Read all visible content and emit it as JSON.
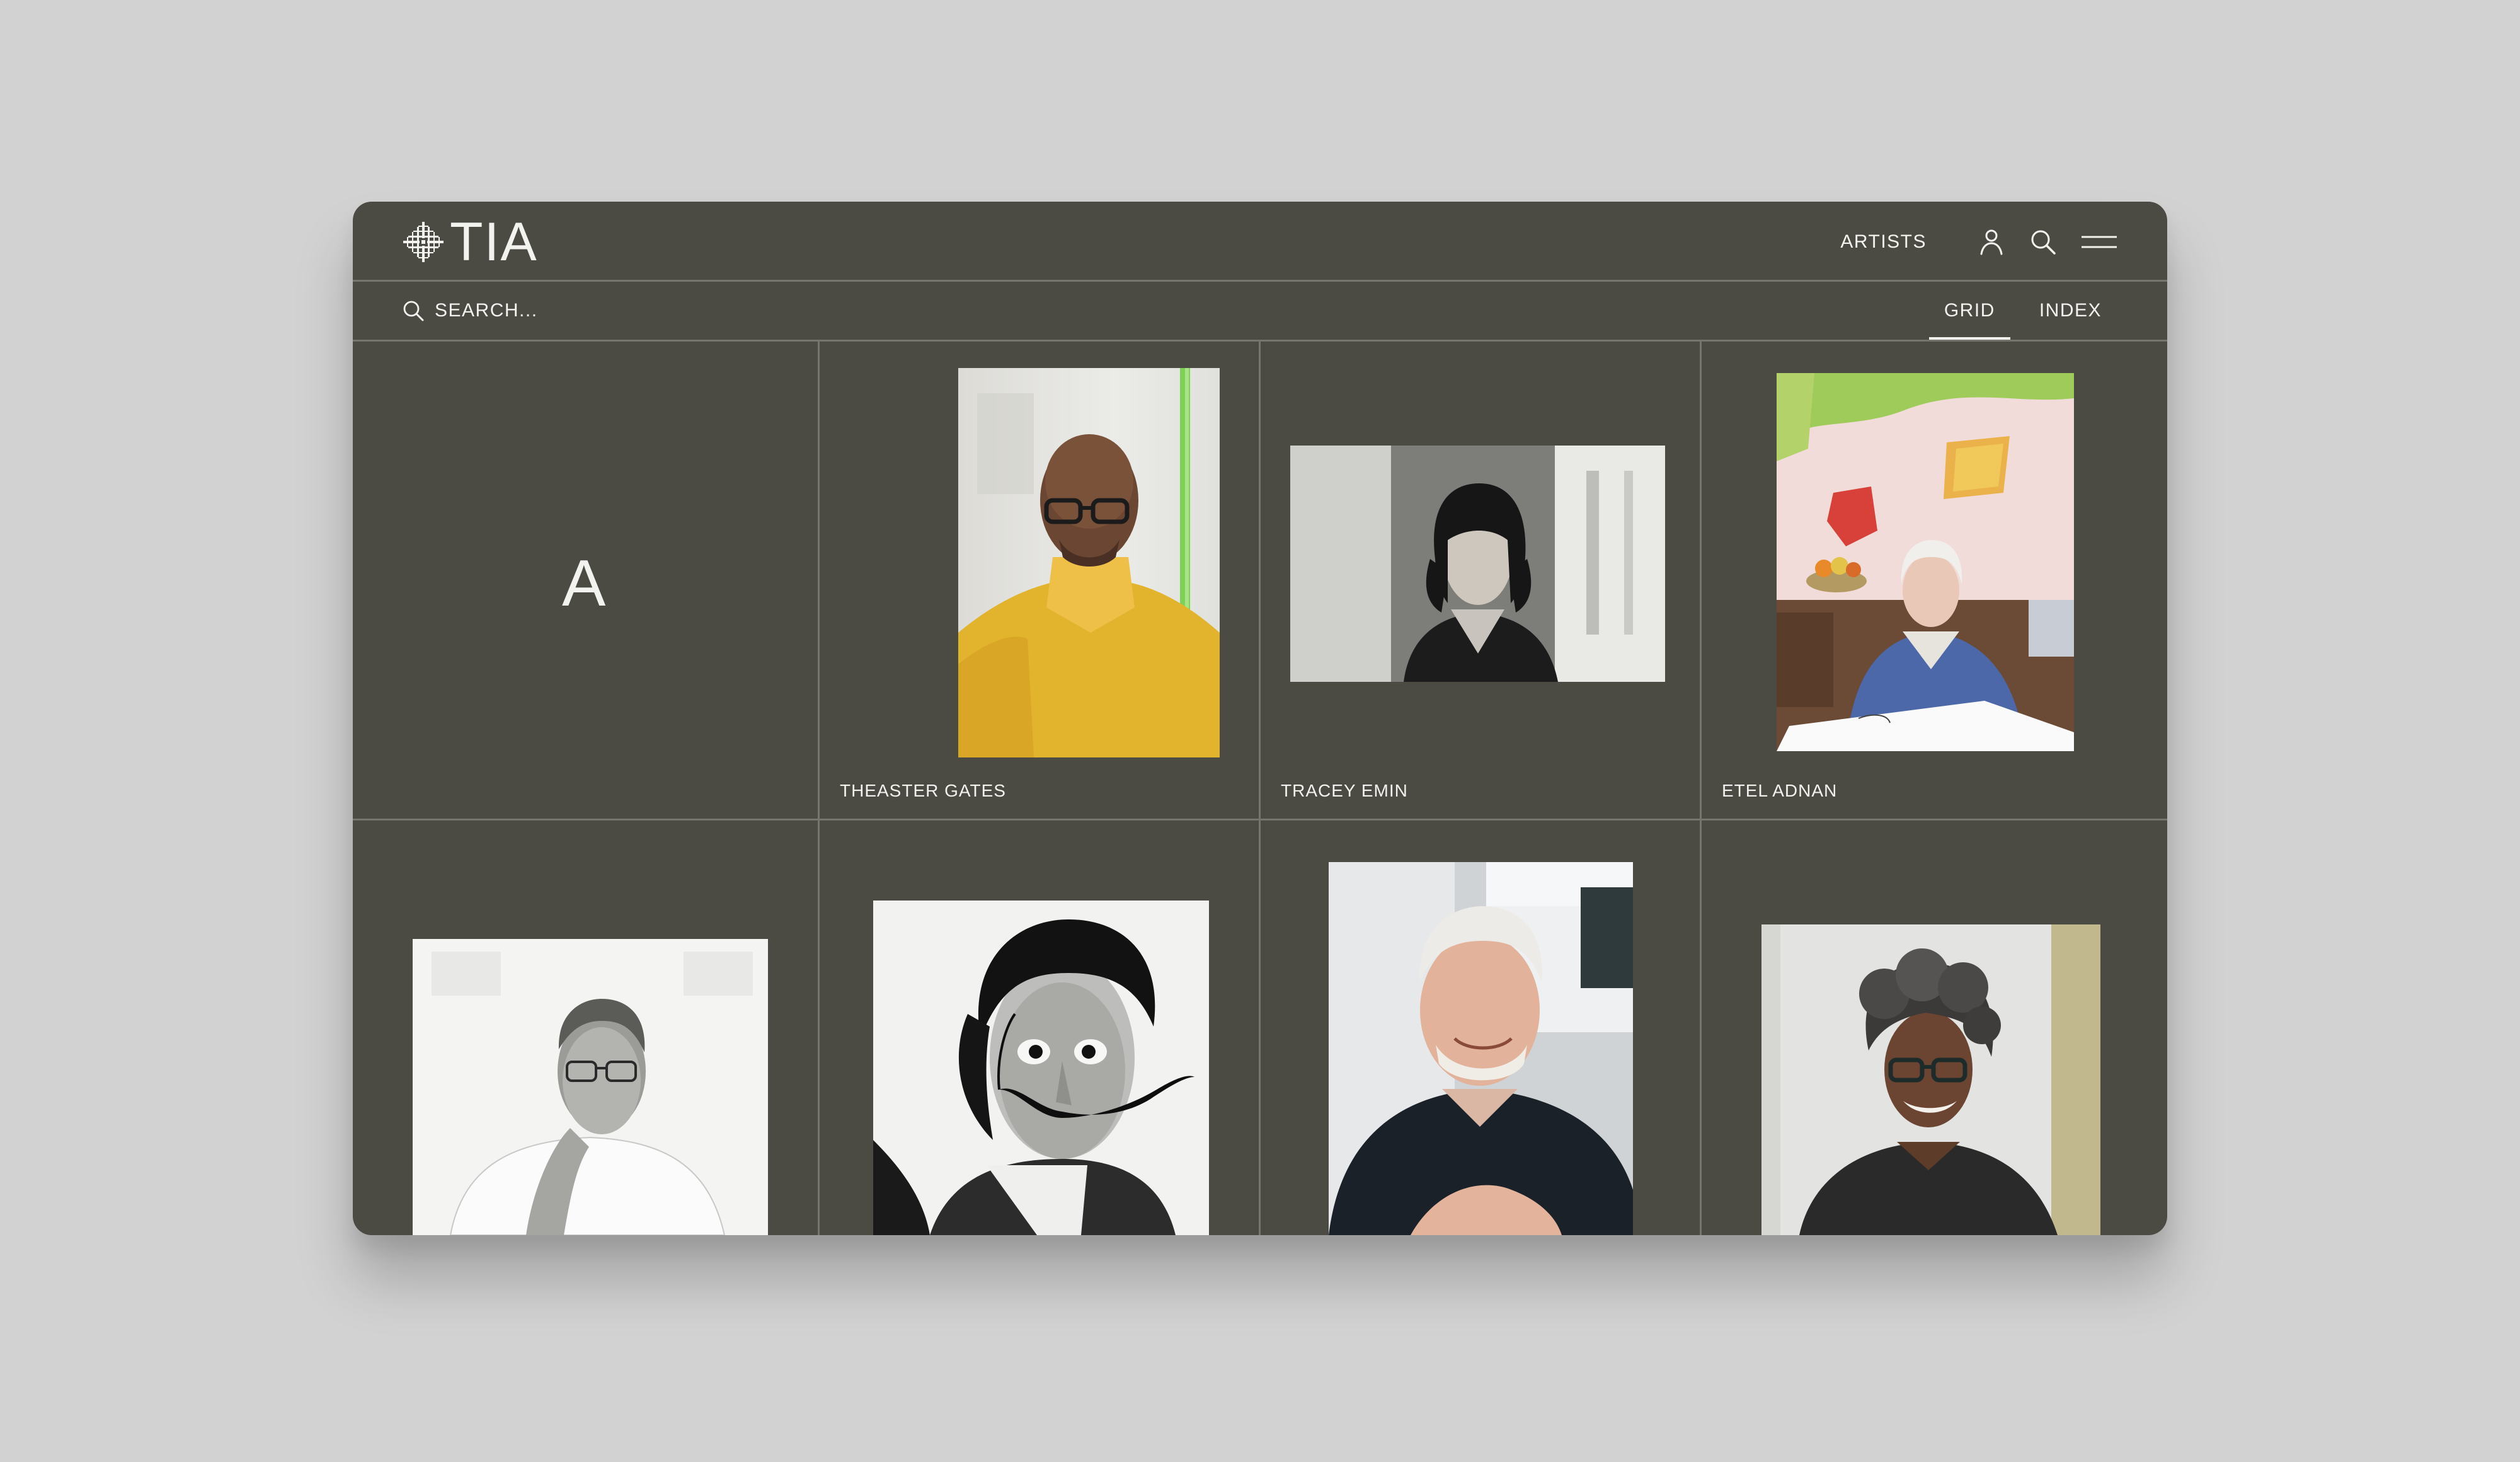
{
  "header": {
    "logo_text": "TIA",
    "nav": {
      "artists_label": "ARTISTS"
    },
    "icons": [
      "user-icon",
      "search-icon",
      "menu-icon"
    ]
  },
  "search": {
    "placeholder": "SEARCH..."
  },
  "view_tabs": [
    {
      "label": "GRID",
      "active": true
    },
    {
      "label": "INDEX",
      "active": false
    }
  ],
  "grid": {
    "section_letter": "A",
    "artists": [
      {
        "name": "THEASTER GATES"
      },
      {
        "name": "TRACEY EMIN"
      },
      {
        "name": "ETEL ADNAN"
      },
      {
        "name": ""
      },
      {
        "name": ""
      },
      {
        "name": ""
      },
      {
        "name": ""
      }
    ]
  },
  "colors": {
    "page_background": "#d2d2d2",
    "panel_background": "#4b4a43",
    "text": "#f2f2ee",
    "divider": "#75746d"
  }
}
